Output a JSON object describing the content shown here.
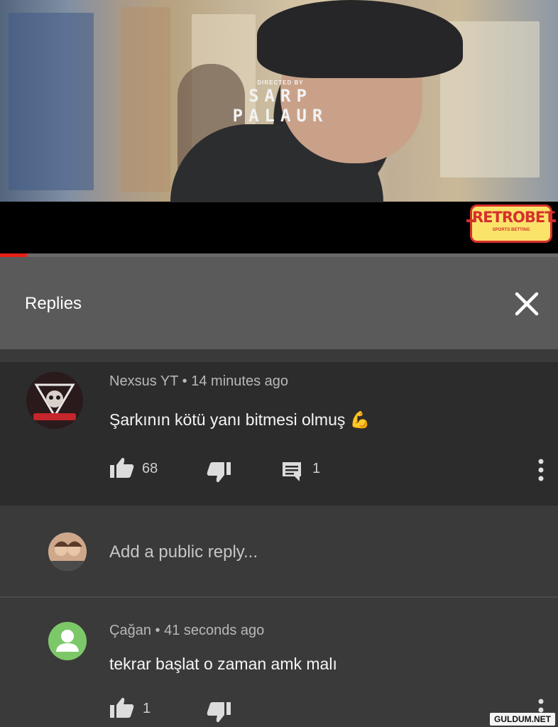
{
  "video": {
    "credit_small": "DIRECTED BY",
    "credit_name": "SARP PALAUR",
    "sponsor_name": "RETROBET",
    "sponsor_sub": "SPORTS BETTING",
    "progress_fraction": 0.048,
    "accent": "#e62117"
  },
  "panel": {
    "title": "Replies",
    "close_icon": "close-icon"
  },
  "comment": {
    "author": "Nexsus YT",
    "separator": "•",
    "time": "14 minutes ago",
    "text": "Şarkının kötü yanı bitmesi olmuş",
    "emoji": "💪",
    "likes": "68",
    "replies": "1"
  },
  "reply_input": {
    "placeholder": "Add a public reply..."
  },
  "reply": {
    "author": "Çağan",
    "separator": "•",
    "time": "41 seconds ago",
    "text": "tekrar başlat o zaman amk malı",
    "likes": "1"
  },
  "watermark": "GULDUM.NET"
}
